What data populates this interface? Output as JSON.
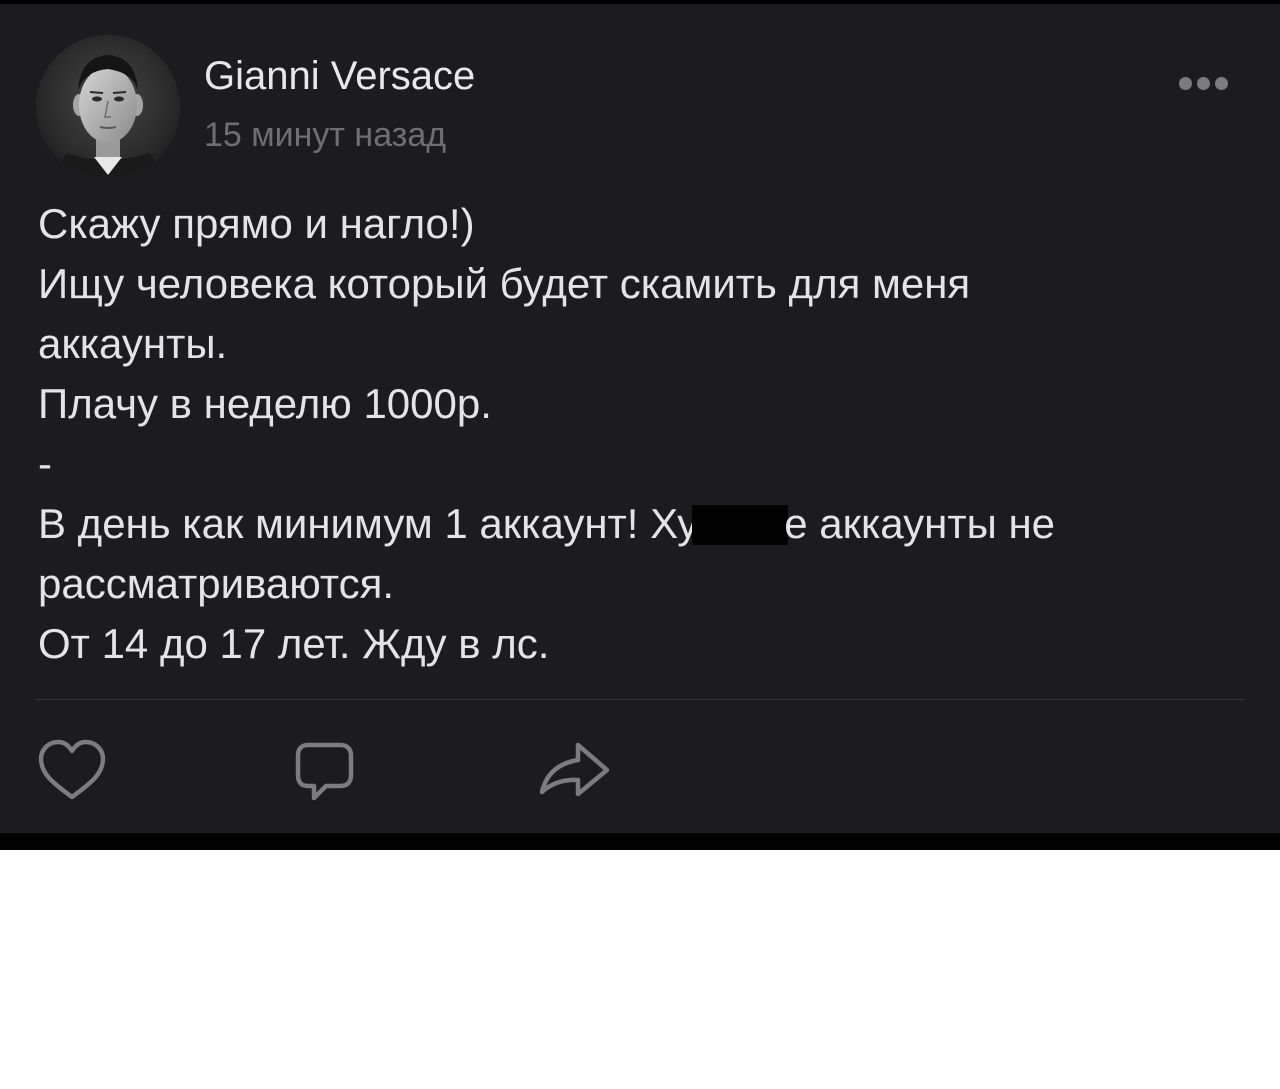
{
  "post": {
    "author": {
      "name": "Gianni Versace",
      "avatar_icon": "profile-photo"
    },
    "time": "15 минут назад",
    "menu_icon": "more-horizontal-icon",
    "body": {
      "line_1": "Скажу прямо и нагло!)",
      "line_2": "Ищу человека который будет скамить для меня",
      "line_3": "аккаунты.",
      "line_4": "Плачу в неделю 1000р.",
      "line_5": "-",
      "line_6_before": "В день как минимум 1 аккаунт! Ху",
      "line_6_after": "е аккаунты не",
      "line_7": "рассматриваются.",
      "line_8": "От 14 до 17 лет. Жду в лс."
    },
    "actions": {
      "like_icon": "heart-icon",
      "comment_icon": "comment-icon",
      "share_icon": "share-icon"
    },
    "colors": {
      "card_background": "#1c1c1e",
      "text": "#e4e4e6",
      "secondary_text": "#6f6f73",
      "icon": "#7b7b80"
    }
  }
}
